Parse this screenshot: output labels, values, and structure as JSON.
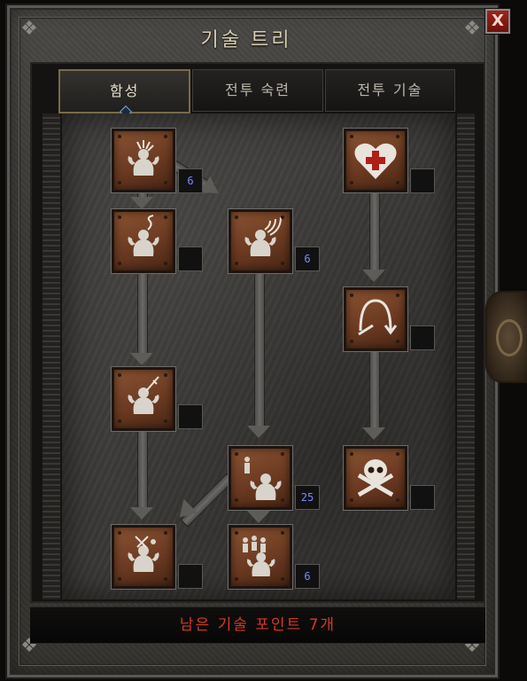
{
  "window": {
    "title": "기술 트리",
    "close_label": "X"
  },
  "tabs": [
    {
      "label": "함성",
      "active": true
    },
    {
      "label": "전투 숙련",
      "active": false
    },
    {
      "label": "전투 기술",
      "active": false
    }
  ],
  "skills": [
    {
      "name": "howl",
      "icon": "shouting-figure-icon",
      "level": "6"
    },
    {
      "name": "find-potion",
      "icon": "figure-smoke-icon",
      "level": ""
    },
    {
      "name": "shout",
      "icon": "figure-waves-icon",
      "level": "6"
    },
    {
      "name": "taunt",
      "icon": "figure-sword-icon",
      "level": ""
    },
    {
      "name": "battle-orders",
      "icon": "figure-summon-icon",
      "level": "25"
    },
    {
      "name": "grim-ward",
      "icon": "figure-crossed-weapons-icon",
      "level": ""
    },
    {
      "name": "battle-command",
      "icon": "three-figures-icon",
      "level": "6"
    },
    {
      "name": "health-heart",
      "icon": "heart-cross-icon",
      "level": ""
    },
    {
      "name": "leap",
      "icon": "arc-leap-icon",
      "level": ""
    },
    {
      "name": "war-cry",
      "icon": "skull-crossbones-icon",
      "level": ""
    }
  ],
  "footer": {
    "remaining_points": "남은 기술 포인트 7개"
  },
  "colors": {
    "footer_text": "#d63828",
    "level_text": "#7b88ff",
    "title_text": "#d9ccb0",
    "skill_bronze": "#8a5332"
  }
}
